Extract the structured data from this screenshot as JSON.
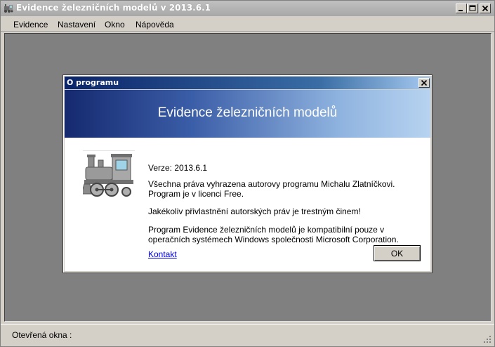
{
  "window": {
    "title": "Evidence železničních modelů v 2013.6.1",
    "icon": "locomotive-app-icon",
    "controls": {
      "minimize_icon": "minimize-icon",
      "maximize_icon": "maximize-icon",
      "close_icon": "close-icon"
    }
  },
  "menu": {
    "items": [
      {
        "label": "Evidence"
      },
      {
        "label": "Nastavení"
      },
      {
        "label": "Okno"
      },
      {
        "label": "Nápověda"
      }
    ]
  },
  "statusbar": {
    "open_windows_label": "Otevřená okna :"
  },
  "dialog": {
    "title": "O programu",
    "banner_title": "Evidence železničních modelů",
    "version_line": "Verze: 2013.6.1",
    "rights_line_1": "Všechna práva vyhrazena autorovy programu Michalu Zlatníčkovi.",
    "rights_line_2": "Program je v licenci Free.",
    "warning": "Jakékoliv přivlastnění autorských práv je trestným činem!",
    "compat_line_1": "Program Evidence železničních modelů je kompatibilní pouze v",
    "compat_line_2": "operačních systémech Windows společnosti Microsoft Corporation.",
    "contact_link": "Kontakt",
    "ok_label": "OK",
    "image_icon": "locomotive-icon"
  },
  "colors": {
    "banner_start": "#15296f",
    "banner_end": "#b7d3f0",
    "mdi_background": "#808080",
    "link": "#0000ee"
  }
}
